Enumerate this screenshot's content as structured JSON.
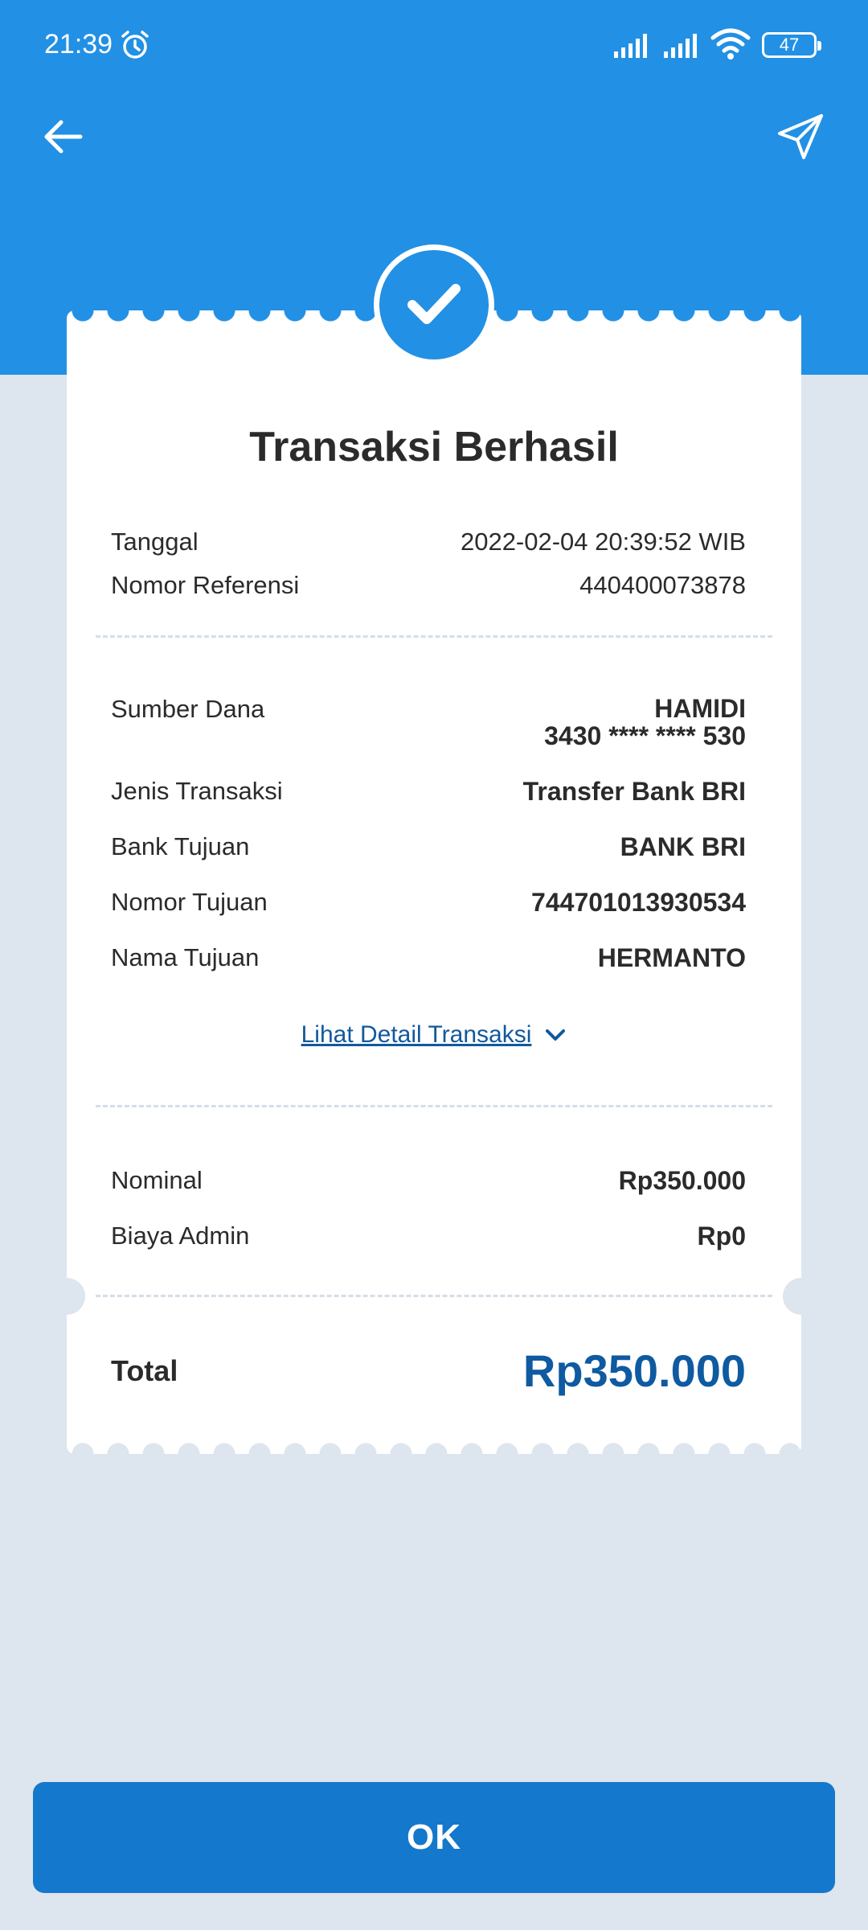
{
  "status_bar": {
    "time": "21:39",
    "battery": "47"
  },
  "header": {
    "back_icon": "arrow-left-icon",
    "share_icon": "send-icon"
  },
  "receipt": {
    "status_icon": "check-circle-icon",
    "title": "Transaksi Berhasil",
    "meta": [
      {
        "label": "Tanggal",
        "value": "2022-02-04 20:39:52 WIB"
      },
      {
        "label": "Nomor Referensi",
        "value": "440400073878"
      }
    ],
    "source": {
      "label": "Sumber Dana",
      "name": "HAMIDI",
      "account": "3430 **** **** 530"
    },
    "details": [
      {
        "label": "Jenis Transaksi",
        "value": "Transfer Bank BRI"
      },
      {
        "label": "Bank Tujuan",
        "value": "BANK BRI"
      },
      {
        "label": "Nomor Tujuan",
        "value": "744701013930534"
      },
      {
        "label": "Nama Tujuan",
        "value": "HERMANTO"
      }
    ],
    "detail_link": "Lihat Detail Transaksi",
    "amounts": [
      {
        "label": "Nominal",
        "value": "Rp350.000"
      },
      {
        "label": "Biaya Admin",
        "value": "Rp0"
      }
    ],
    "total": {
      "label": "Total",
      "value": "Rp350.000"
    }
  },
  "ok_button": "OK",
  "colors": {
    "primary": "#2290e4",
    "button": "#1478cc",
    "total_text": "#0f5aa0",
    "background": "#dde5ee"
  }
}
